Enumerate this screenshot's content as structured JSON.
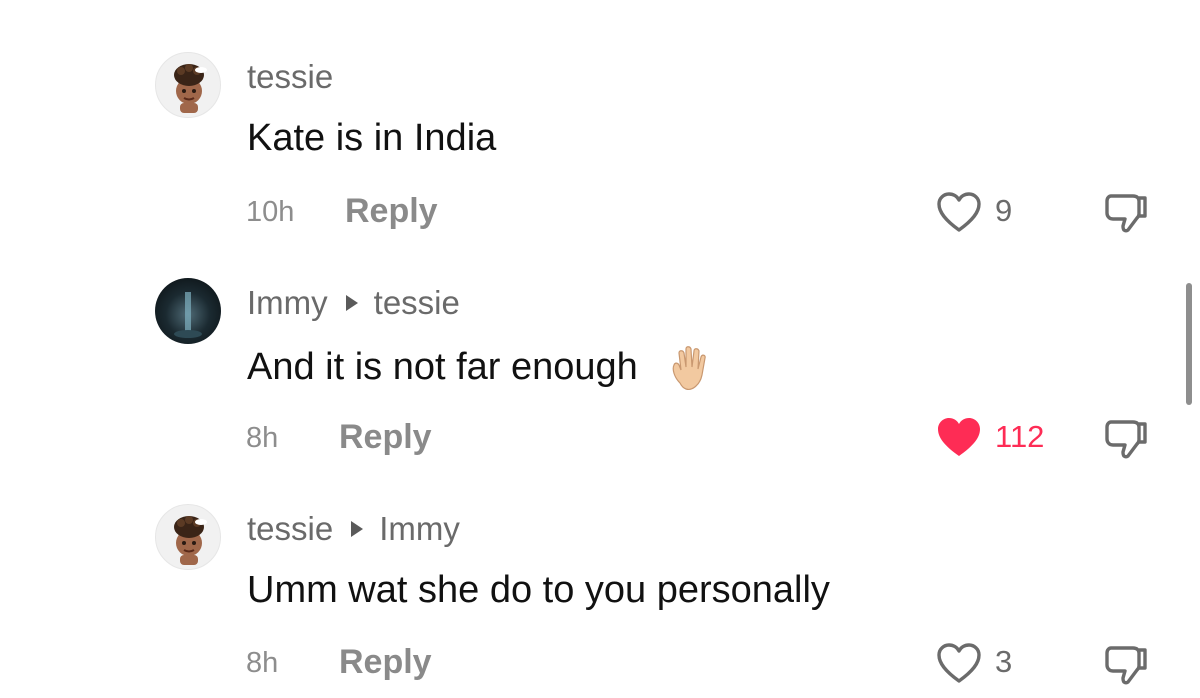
{
  "comments": [
    {
      "username": "tessie",
      "reply_to": "",
      "text": "Kate is in India",
      "time": "10h",
      "reply_label": "Reply",
      "likes": "9",
      "liked": false,
      "avatar": "memoji-avatar"
    },
    {
      "username": "Immy",
      "reply_to": "tessie",
      "text": "And it is not far enough",
      "emoji": "raised-hand-emoji",
      "time": "8h",
      "reply_label": "Reply",
      "likes": "112",
      "liked": true,
      "avatar": "photo-avatar"
    },
    {
      "username": "tessie",
      "reply_to": "Immy",
      "text": "Umm wat she do to you personally",
      "time": "8h",
      "reply_label": "Reply",
      "likes": "3",
      "liked": false,
      "avatar": "memoji-avatar"
    }
  ],
  "colors": {
    "like_active": "#fe2c55",
    "text": "#111111",
    "muted": "#8a8a8a"
  },
  "icons": {
    "like": "heart-icon",
    "dislike": "thumbs-down-icon",
    "reply_arrow": "caret-right-icon"
  }
}
